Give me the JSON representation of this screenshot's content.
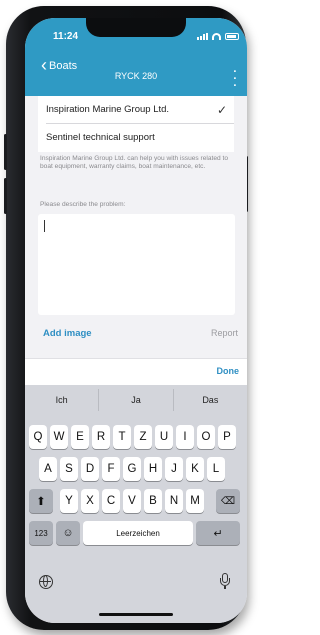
{
  "status": {
    "time": "11:24"
  },
  "nav": {
    "back_label": "Boats",
    "title": "RYCK 280",
    "more_icon": "ellipsis-vertical-icon"
  },
  "recipients": [
    {
      "label": "Inspiration Marine Group Ltd.",
      "selected": true
    },
    {
      "label": "Sentinel technical support",
      "selected": false
    }
  ],
  "help_text": "Inspiration Marine Group Ltd. can help you with issues related to boat equipment, warranty claims, boat maintenance, etc.",
  "form": {
    "describe_label": "Please describe the problem:",
    "problem_text": ""
  },
  "actions": {
    "add_image": "Add image",
    "report": "Report"
  },
  "keyboard": {
    "done": "Done",
    "suggestions": [
      "Ich",
      "Ja",
      "Das"
    ],
    "row1": [
      "Q",
      "W",
      "E",
      "R",
      "T",
      "Z",
      "U",
      "I",
      "O",
      "P"
    ],
    "row2": [
      "A",
      "S",
      "D",
      "F",
      "G",
      "H",
      "J",
      "K",
      "L"
    ],
    "row3": [
      "Y",
      "X",
      "C",
      "V",
      "B",
      "N",
      "M"
    ],
    "numbers_key": "123",
    "space_key": "Leerzeichen"
  },
  "colors": {
    "accent": "#2f9ac4",
    "link": "#2f8fc3",
    "keyboard_bg": "#d3d5db"
  }
}
